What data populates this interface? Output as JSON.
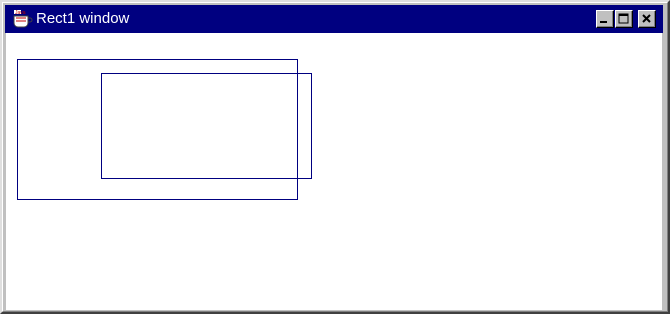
{
  "window": {
    "title": "Rect1 window",
    "icon": "java-cup-icon",
    "buttons": [
      "minimize-icon",
      "maximize-icon",
      "close-icon"
    ]
  },
  "canvas": {
    "background": "#ffffff",
    "stroke_color": "#000080",
    "shapes": [
      "rectangle",
      "rectangle"
    ]
  },
  "colors": {
    "title_bar": "#000080",
    "title_text": "#ffffff",
    "frame": "#c0c0c0"
  }
}
